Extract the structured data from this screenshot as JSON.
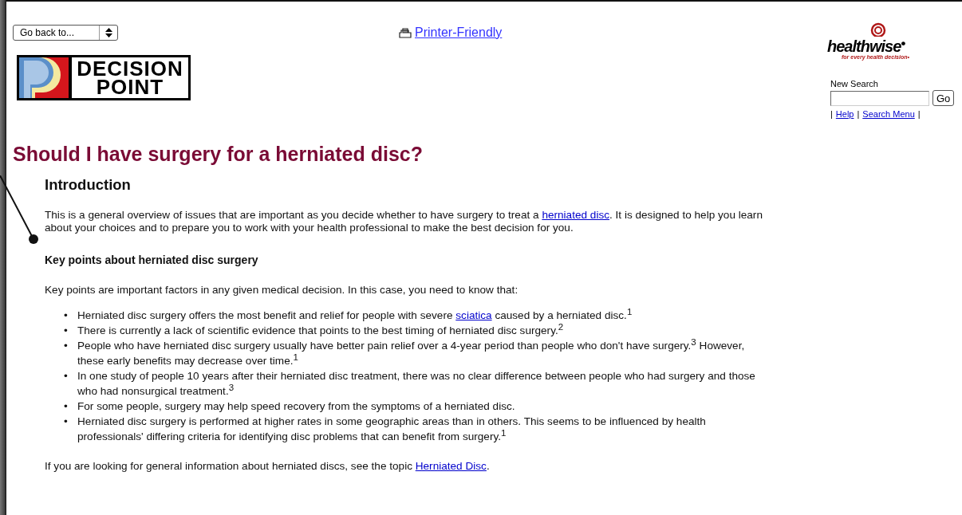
{
  "header": {
    "go_back": {
      "value": "Go back to..."
    },
    "printer_link": "Printer-Friendly",
    "logo": {
      "line_1": "DECISION",
      "line_2": "POINT"
    }
  },
  "sidebar": {
    "brand": "healthwise",
    "brand_mark": "•",
    "tagline": "for every health decision",
    "tagline_mark": "•",
    "search_label": "New Search",
    "go_button": "Go",
    "links": [
      {
        "kind": "separator",
        "text": "|"
      },
      {
        "kind": "link",
        "text": "Help"
      },
      {
        "kind": "separator",
        "text": "|"
      },
      {
        "kind": "link",
        "text": "Search Menu"
      },
      {
        "kind": "separator",
        "text": "|"
      }
    ]
  },
  "title": "Should I have surgery for a herniated disc?",
  "section_heading": "Introduction",
  "intro": [
    {
      "text": "This is a general overview of issues that are important as you decide whether to have surgery to treat a "
    },
    {
      "link": "herniated disc"
    },
    {
      "text": ". It is designed to help you learn about your choices and to prepare you to work with your health professional to make the best decision for you."
    }
  ],
  "subheading": "Key points about herniated disc surgery",
  "key_points_intro": "Key points are important factors in any given medical decision. In this case, you need to know that:",
  "bullets": [
    {
      "marker": "•",
      "parts": [
        {
          "text": "Herniated disc surgery offers the most benefit and relief for people with severe "
        },
        {
          "link": "sciatica"
        },
        {
          "text": " caused by a herniated disc.$^{1}$"
        }
      ]
    },
    {
      "marker": "•",
      "parts": [
        {
          "text": "There is currently a lack of scientific evidence that points to the best timing of herniated disc surgery.$^{2}$"
        }
      ]
    },
    {
      "marker": "•",
      "parts": [
        {
          "text": "People who have herniated disc surgery usually have better pain relief over a 4-year period than people who don't have surgery.$^{3}$ However, these early benefits may decrease over time.$^{1}$"
        }
      ]
    },
    {
      "marker": "•",
      "parts": [
        {
          "text": "In one study of people 10 years after their herniated disc treatment, there was no clear difference between people who had surgery and those who had nonsurgical treatment.$^{3}$"
        }
      ]
    },
    {
      "marker": "•",
      "parts": [
        {
          "text": "For some people, surgery may help speed recovery from the symptoms of a herniated disc."
        }
      ]
    },
    {
      "marker": "•",
      "parts": [
        {
          "text": "Herniated disc surgery is performed at higher rates in some geographic areas than in others. This seems to be influenced by health professionals' differing criteria for identifying disc problems that can benefit from surgery.$^{1}$"
        }
      ]
    }
  ],
  "footer_text": [
    {
      "text": "If you are looking for general information about herniated discs, see the topic "
    },
    {
      "link": "Herniated Disc"
    },
    {
      "text": "."
    }
  ]
}
